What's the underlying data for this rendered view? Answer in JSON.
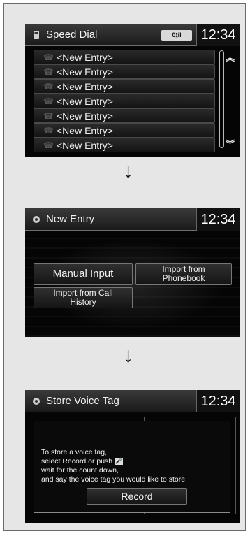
{
  "speed_dial": {
    "title": "Speed Dial",
    "time": "12:34",
    "status": "0⟟il",
    "entries": [
      "<New Entry>",
      "<New Entry>",
      "<New Entry>",
      "<New Entry>",
      "<New Entry>",
      "<New Entry>",
      "<New Entry>"
    ]
  },
  "arrows": [
    "↓",
    "↓"
  ],
  "new_entry": {
    "title": "New Entry",
    "time": "12:34",
    "manual_input": "Manual Input",
    "import_phonebook": "Import from\nPhonebook",
    "import_history": "Import from Call\nHistory"
  },
  "voice_tag": {
    "title": "Store Voice Tag",
    "time": "12:34",
    "line1": "To store a voice tag,",
    "line2_prefix": "select Record or push ",
    "talk_icon": "talk-icon",
    "line3": "wait for the count down,",
    "line4": "and say the voice tag you would like to store.",
    "record": "Record"
  },
  "icons": {
    "speed_dial_header": "phone-icon",
    "new_entry_header": "gear-icon",
    "voice_tag_header": "gear-icon",
    "scroll_up": "chevron-up-icon",
    "scroll_down": "chevron-down-icon"
  }
}
